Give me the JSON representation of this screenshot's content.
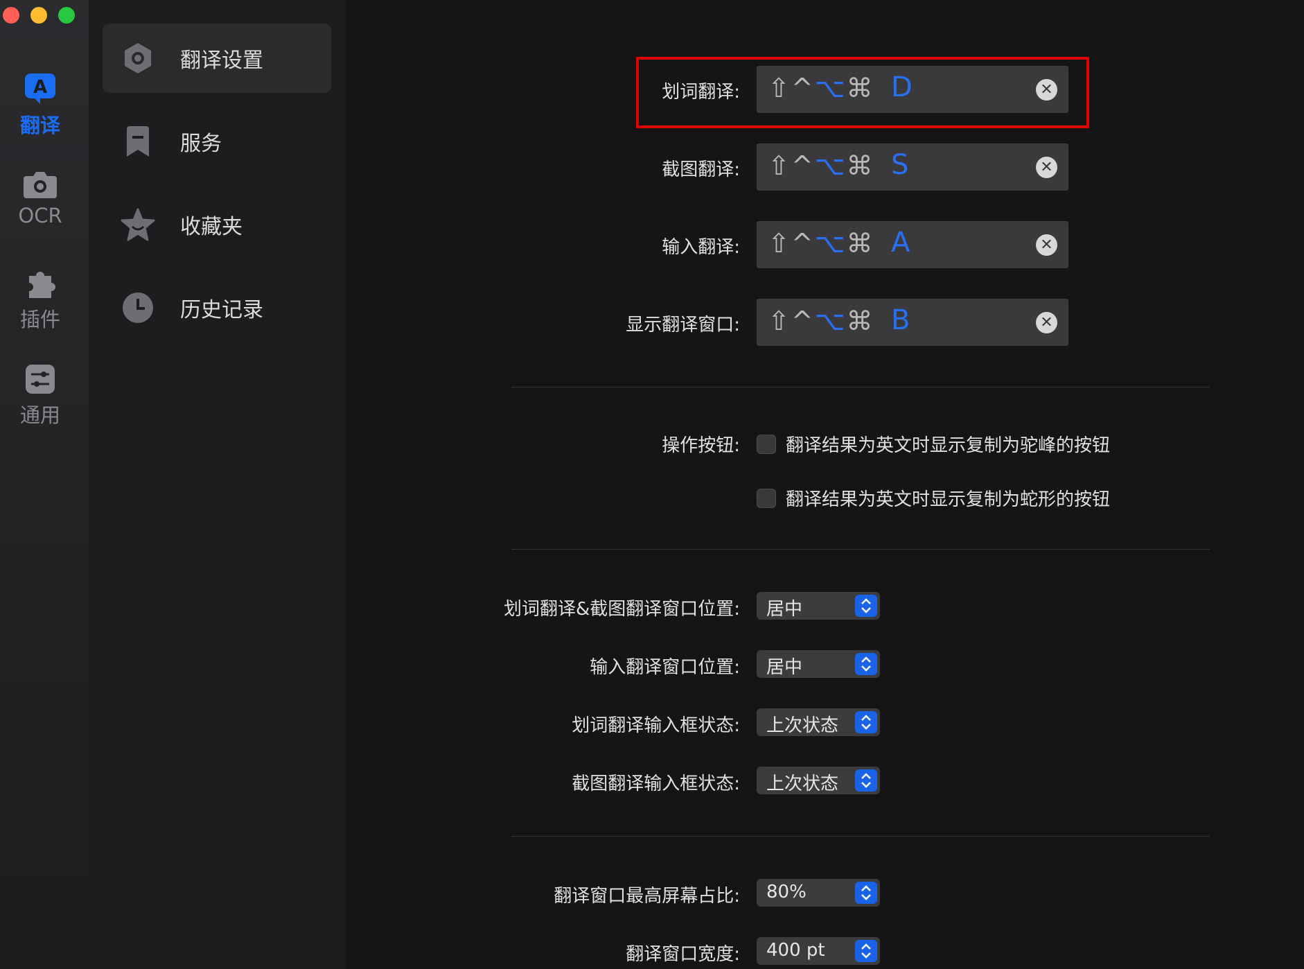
{
  "iconbar": {
    "items": [
      {
        "label": "翻译",
        "icon": "translate-icon",
        "active": true
      },
      {
        "label": "OCR",
        "icon": "camera-icon",
        "active": false
      },
      {
        "label": "插件",
        "icon": "puzzle-icon",
        "active": false
      },
      {
        "label": "通用",
        "icon": "sliders-icon",
        "active": false
      }
    ]
  },
  "sidebar": {
    "items": [
      {
        "label": "翻译设置",
        "icon": "gear-icon"
      },
      {
        "label": "服务",
        "icon": "bookmark-icon"
      },
      {
        "label": "收藏夹",
        "icon": "star-icon"
      },
      {
        "label": "历史记录",
        "icon": "clock-icon"
      }
    ]
  },
  "hotkeys": [
    {
      "label": "划词翻译:",
      "mods_gray": "⇧^",
      "mods_blue": "⌥",
      "mods_gray2": "⌘",
      "key": "D"
    },
    {
      "label": "截图翻译:",
      "mods_gray": "⇧^",
      "mods_blue": "⌥",
      "mods_gray2": "⌘",
      "key": "S"
    },
    {
      "label": "输入翻译:",
      "mods_gray": "⇧^",
      "mods_blue": "⌥",
      "mods_gray2": "⌘",
      "key": "A"
    },
    {
      "label": "显示翻译窗口:",
      "mods_gray": "⇧^",
      "mods_blue": "⌥",
      "mods_gray2": "⌘",
      "key": "B"
    }
  ],
  "action_buttons": {
    "label": "操作按钮:",
    "options": [
      {
        "label": "翻译结果为英文时显示复制为驼峰的按钮",
        "checked": false
      },
      {
        "label": "翻译结果为英文时显示复制为蛇形的按钮",
        "checked": false
      }
    ]
  },
  "selects": [
    {
      "label": "划词翻译&截图翻译窗口位置:",
      "value": "居中"
    },
    {
      "label": "输入翻译窗口位置:",
      "value": "居中"
    },
    {
      "label": "划词翻译输入框状态:",
      "value": "上次状态"
    },
    {
      "label": "截图翻译输入框状态:",
      "value": "上次状态"
    },
    {
      "label": "翻译窗口最高屏幕占比:",
      "value": "80%"
    },
    {
      "label": "翻译窗口宽度:",
      "value": "400 pt"
    }
  ],
  "colors": {
    "accent": "#1a6cf3",
    "highlight": "#e00000"
  }
}
